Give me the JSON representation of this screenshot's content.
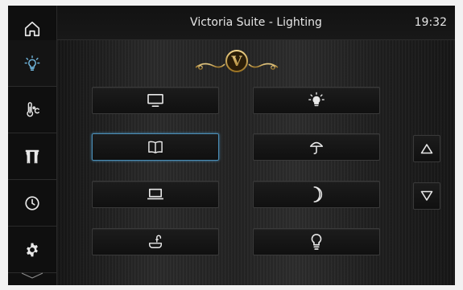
{
  "header": {
    "title": "Victoria Suite - Lighting",
    "time": "19:32"
  },
  "sidebar": {
    "items": [
      {
        "name": "home",
        "icon": "home-icon"
      },
      {
        "name": "lighting",
        "icon": "bulb-icon",
        "active": true
      },
      {
        "name": "climate",
        "icon": "thermometer-celsius-icon"
      },
      {
        "name": "curtains",
        "icon": "curtains-icon"
      },
      {
        "name": "schedule",
        "icon": "clock-icon"
      },
      {
        "name": "settings",
        "icon": "gear-icon"
      }
    ],
    "more_icon": "chevron-down-icon"
  },
  "logo": {
    "letter": "V"
  },
  "scenes": [
    {
      "icon": "tv-icon"
    },
    {
      "icon": "lamp-bright-icon"
    },
    {
      "icon": "book-icon",
      "selected": true
    },
    {
      "icon": "table-lamp-icon"
    },
    {
      "icon": "laptop-icon"
    },
    {
      "icon": "moon-icon"
    },
    {
      "icon": "bathtub-icon"
    },
    {
      "icon": "light-bulb-icon"
    }
  ],
  "scroll": {
    "up_icon": "triangle-up-icon",
    "down_icon": "triangle-down-icon"
  },
  "colors": {
    "accent": "#4a8db6",
    "active_icon": "#6fb3d9",
    "gold": "#c9a24a",
    "icon": "#e8e8e8"
  }
}
